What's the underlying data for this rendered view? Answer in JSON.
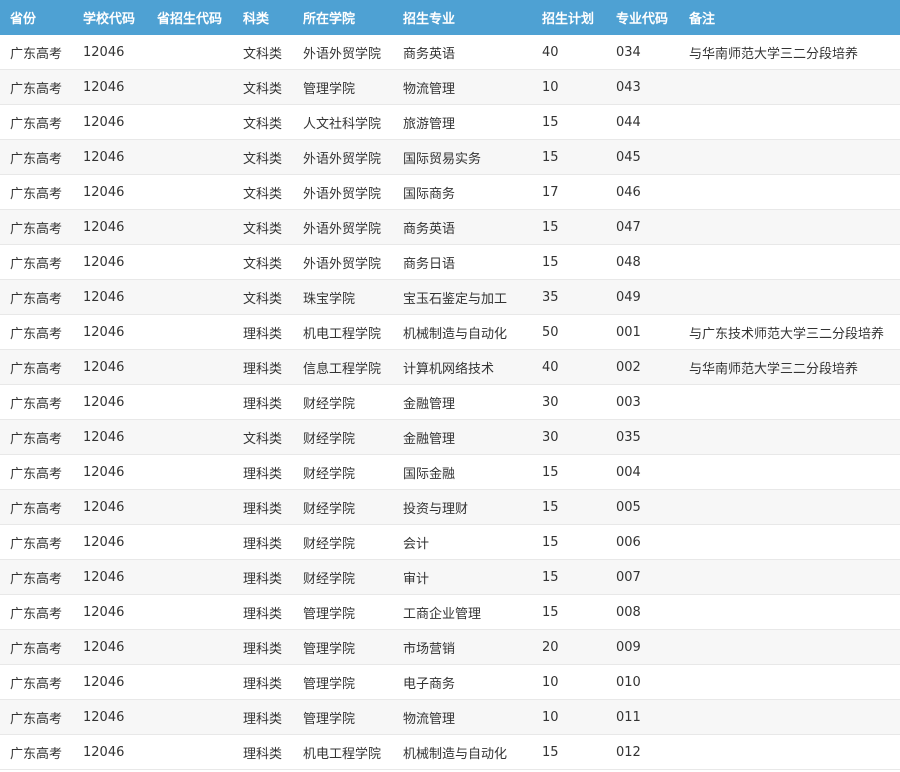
{
  "table": {
    "headers": [
      "省份",
      "学校代码",
      "省招生代码",
      "科类",
      "所在学院",
      "招生专业",
      "招生计划",
      "专业代码",
      "备注"
    ],
    "rows": [
      [
        "广东高考",
        "12046",
        "",
        "文科类",
        "外语外贸学院",
        "商务英语",
        "40",
        "034",
        "与华南师范大学三二分段培养"
      ],
      [
        "广东高考",
        "12046",
        "",
        "文科类",
        "管理学院",
        "物流管理",
        "10",
        "043",
        ""
      ],
      [
        "广东高考",
        "12046",
        "",
        "文科类",
        "人文社科学院",
        "旅游管理",
        "15",
        "044",
        ""
      ],
      [
        "广东高考",
        "12046",
        "",
        "文科类",
        "外语外贸学院",
        "国际贸易实务",
        "15",
        "045",
        ""
      ],
      [
        "广东高考",
        "12046",
        "",
        "文科类",
        "外语外贸学院",
        "国际商务",
        "17",
        "046",
        ""
      ],
      [
        "广东高考",
        "12046",
        "",
        "文科类",
        "外语外贸学院",
        "商务英语",
        "15",
        "047",
        ""
      ],
      [
        "广东高考",
        "12046",
        "",
        "文科类",
        "外语外贸学院",
        "商务日语",
        "15",
        "048",
        ""
      ],
      [
        "广东高考",
        "12046",
        "",
        "文科类",
        "珠宝学院",
        "宝玉石鉴定与加工",
        "35",
        "049",
        ""
      ],
      [
        "广东高考",
        "12046",
        "",
        "理科类",
        "机电工程学院",
        "机械制造与自动化",
        "50",
        "001",
        "与广东技术师范大学三二分段培养"
      ],
      [
        "广东高考",
        "12046",
        "",
        "理科类",
        "信息工程学院",
        "计算机网络技术",
        "40",
        "002",
        "与华南师范大学三二分段培养"
      ],
      [
        "广东高考",
        "12046",
        "",
        "理科类",
        "财经学院",
        "金融管理",
        "30",
        "003",
        ""
      ],
      [
        "广东高考",
        "12046",
        "",
        "文科类",
        "财经学院",
        "金融管理",
        "30",
        "035",
        ""
      ],
      [
        "广东高考",
        "12046",
        "",
        "理科类",
        "财经学院",
        "国际金融",
        "15",
        "004",
        ""
      ],
      [
        "广东高考",
        "12046",
        "",
        "理科类",
        "财经学院",
        "投资与理财",
        "15",
        "005",
        ""
      ],
      [
        "广东高考",
        "12046",
        "",
        "理科类",
        "财经学院",
        "会计",
        "15",
        "006",
        ""
      ],
      [
        "广东高考",
        "12046",
        "",
        "理科类",
        "财经学院",
        "审计",
        "15",
        "007",
        ""
      ],
      [
        "广东高考",
        "12046",
        "",
        "理科类",
        "管理学院",
        "工商企业管理",
        "15",
        "008",
        ""
      ],
      [
        "广东高考",
        "12046",
        "",
        "理科类",
        "管理学院",
        "市场营销",
        "20",
        "009",
        ""
      ],
      [
        "广东高考",
        "12046",
        "",
        "理科类",
        "管理学院",
        "电子商务",
        "10",
        "010",
        ""
      ],
      [
        "广东高考",
        "12046",
        "",
        "理科类",
        "管理学院",
        "物流管理",
        "10",
        "011",
        ""
      ],
      [
        "广东高考",
        "12046",
        "",
        "理科类",
        "机电工程学院",
        "机械制造与自动化",
        "15",
        "012",
        ""
      ]
    ]
  }
}
